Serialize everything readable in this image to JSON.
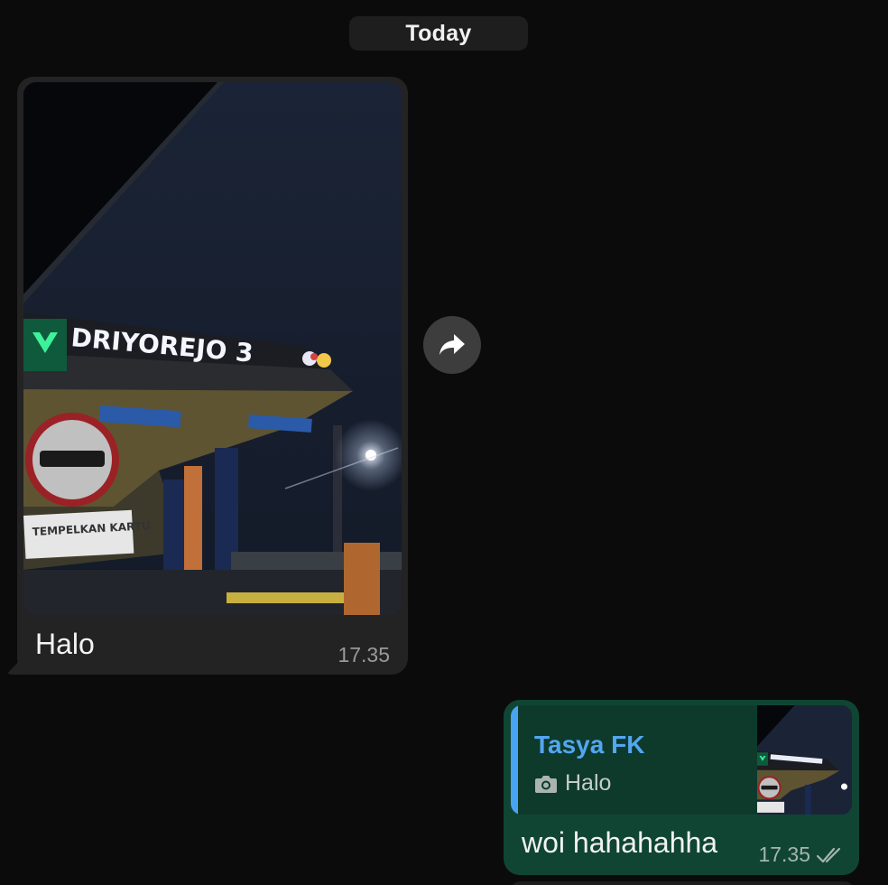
{
  "date_separator": "Today",
  "incoming_message": {
    "caption": "Halo",
    "time": "17.35",
    "photo_sign_text": "DRIYOREJO 3",
    "photo_board_text": "TEMPELKAN KARTU"
  },
  "forward_button": {
    "icon": "forward-arrow-icon"
  },
  "outgoing_message": {
    "reply_author": "Tasya FK",
    "reply_preview": "Halo",
    "reply_preview_icon": "camera-icon",
    "text": "woi hahahahha",
    "time": "17.35",
    "status_icon": "double-check-icon"
  },
  "colors": {
    "background": "#0b0b0b",
    "incoming_bubble": "#232323",
    "outgoing_bubble": "#104534",
    "quote_accent": "#4aa3f2",
    "quote_author": "#53a6f0"
  }
}
